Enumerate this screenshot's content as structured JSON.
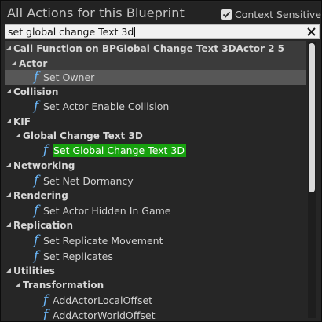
{
  "header": {
    "title": "All Actions for this Blueprint",
    "context_sensitive_label": "Context Sensitive",
    "context_sensitive_checked": true
  },
  "search": {
    "value": "set global change Text 3d"
  },
  "tree": {
    "root": "Call Function on BPGlobal Change Text 3DActor 2 5",
    "actor": "Actor",
    "set_owner": "Set Owner",
    "collision": "Collision",
    "set_actor_enable_collision": "Set Actor Enable Collision",
    "kif": "KIF",
    "global_change_text_3d": "Global Change Text 3D",
    "set_global_change_text_3d": "Set Global Change Text 3D",
    "networking": "Networking",
    "set_net_dormancy": "Set Net Dormancy",
    "rendering": "Rendering",
    "set_actor_hidden_in_game": "Set Actor Hidden In Game",
    "replication": "Replication",
    "set_replicate_movement": "Set Replicate Movement",
    "set_replicates": "Set Replicates",
    "utilities": "Utilities",
    "transformation": "Transformation",
    "add_actor_local_offset": "AddActorLocalOffset",
    "add_actor_world_offset": "AddActorWorldOffset"
  },
  "icons": {
    "function_glyph": "f",
    "function_color": "#6ab4f4",
    "highlight_color": "#17a10e"
  }
}
